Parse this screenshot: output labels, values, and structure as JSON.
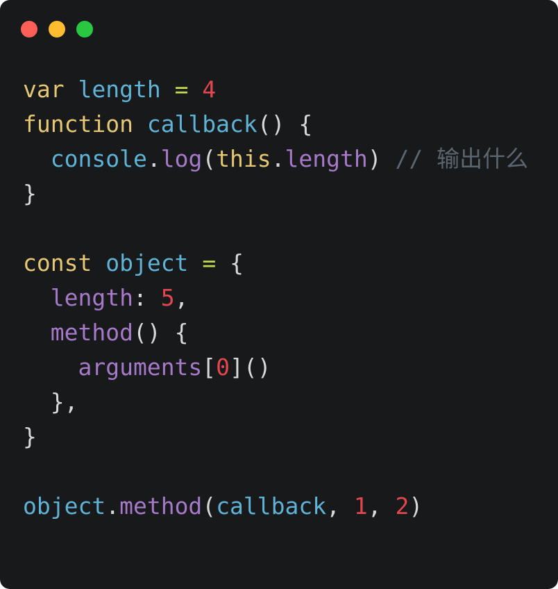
{
  "colors": {
    "background": "#18191b",
    "close": "#fe5f57",
    "minimize": "#febc2e",
    "maximize": "#28c840",
    "keyword": "#e6c773",
    "variable": "#5fb3d6",
    "operator": "#c3d84f",
    "number": "#e0474f",
    "punctuation": "#d9d9d9",
    "property": "#a779c9",
    "comment": "#5b6670"
  },
  "window_controls": [
    "close",
    "minimize",
    "maximize"
  ],
  "code": {
    "lines": [
      [
        {
          "t": "var",
          "k": "keyword"
        },
        {
          "t": " ",
          "k": "plain"
        },
        {
          "t": "length",
          "k": "variable"
        },
        {
          "t": " ",
          "k": "plain"
        },
        {
          "t": "=",
          "k": "operator"
        },
        {
          "t": " ",
          "k": "plain"
        },
        {
          "t": "4",
          "k": "number"
        }
      ],
      [
        {
          "t": "function",
          "k": "keyword"
        },
        {
          "t": " ",
          "k": "plain"
        },
        {
          "t": "callback",
          "k": "variable"
        },
        {
          "t": "() {",
          "k": "punctuation"
        }
      ],
      [
        {
          "t": "  ",
          "k": "plain"
        },
        {
          "t": "console",
          "k": "variable"
        },
        {
          "t": ".",
          "k": "punctuation"
        },
        {
          "t": "log",
          "k": "property"
        },
        {
          "t": "(",
          "k": "punctuation"
        },
        {
          "t": "this",
          "k": "keyword"
        },
        {
          "t": ".",
          "k": "punctuation"
        },
        {
          "t": "length",
          "k": "property"
        },
        {
          "t": ")",
          "k": "punctuation"
        },
        {
          "t": " ",
          "k": "plain"
        },
        {
          "t": "// 输出什么",
          "k": "comment"
        }
      ],
      [
        {
          "t": "}",
          "k": "punctuation"
        }
      ],
      [],
      [
        {
          "t": "const",
          "k": "keyword"
        },
        {
          "t": " ",
          "k": "plain"
        },
        {
          "t": "object",
          "k": "variable"
        },
        {
          "t": " ",
          "k": "plain"
        },
        {
          "t": "=",
          "k": "operator"
        },
        {
          "t": " ",
          "k": "plain"
        },
        {
          "t": "{",
          "k": "punctuation"
        }
      ],
      [
        {
          "t": "  ",
          "k": "plain"
        },
        {
          "t": "length",
          "k": "property"
        },
        {
          "t": ": ",
          "k": "punctuation"
        },
        {
          "t": "5",
          "k": "number"
        },
        {
          "t": ",",
          "k": "punctuation"
        }
      ],
      [
        {
          "t": "  ",
          "k": "plain"
        },
        {
          "t": "method",
          "k": "property"
        },
        {
          "t": "() {",
          "k": "punctuation"
        }
      ],
      [
        {
          "t": "    ",
          "k": "plain"
        },
        {
          "t": "arguments",
          "k": "property"
        },
        {
          "t": "[",
          "k": "punctuation"
        },
        {
          "t": "0",
          "k": "number"
        },
        {
          "t": "]()",
          "k": "punctuation"
        }
      ],
      [
        {
          "t": "  ",
          "k": "plain"
        },
        {
          "t": "},",
          "k": "punctuation"
        }
      ],
      [
        {
          "t": "}",
          "k": "punctuation"
        }
      ],
      [],
      [
        {
          "t": "object",
          "k": "variable"
        },
        {
          "t": ".",
          "k": "punctuation"
        },
        {
          "t": "method",
          "k": "property"
        },
        {
          "t": "(",
          "k": "punctuation"
        },
        {
          "t": "callback",
          "k": "variable"
        },
        {
          "t": ", ",
          "k": "punctuation"
        },
        {
          "t": "1",
          "k": "number"
        },
        {
          "t": ", ",
          "k": "punctuation"
        },
        {
          "t": "2",
          "k": "number"
        },
        {
          "t": ")",
          "k": "punctuation"
        }
      ]
    ]
  }
}
